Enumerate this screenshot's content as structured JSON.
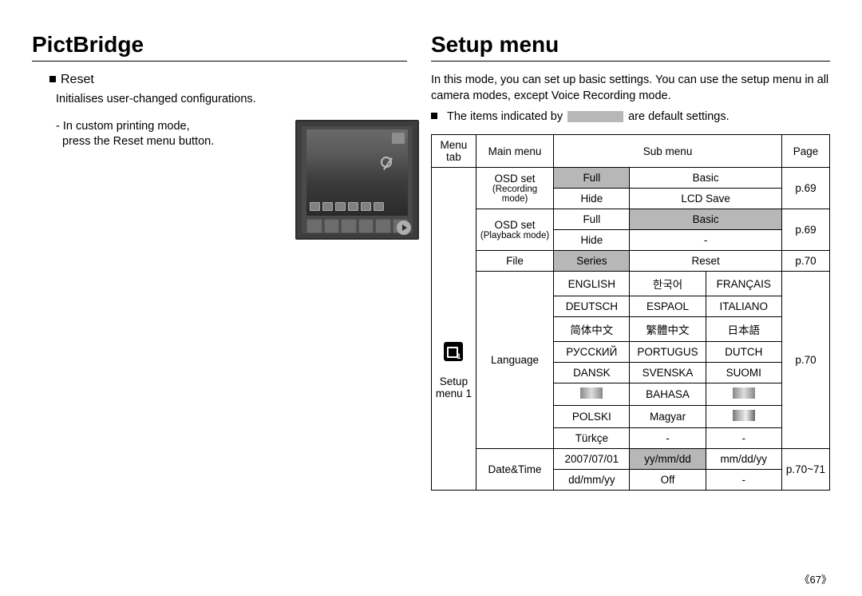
{
  "left": {
    "heading": "PictBridge",
    "section_title": "Reset",
    "desc": "Initialises user-changed configurations.",
    "note1": "- In custom printing mode,",
    "note2": "press the Reset menu button."
  },
  "right": {
    "heading": "Setup menu",
    "intro": "In this mode, you can set up basic settings. You can use the setup menu in all camera modes, except Voice Recording mode.",
    "legend_before": "The items indicated by",
    "legend_after": "are default settings."
  },
  "table": {
    "headers": {
      "tab": "Menu tab",
      "main": "Main menu",
      "sub": "Sub menu",
      "page": "Page"
    },
    "menutab_label": "Setup menu 1",
    "osd_rec": {
      "label": "OSD set",
      "sub": "(Recording mode)",
      "full": "Full",
      "basic": "Basic",
      "hide": "Hide",
      "lcd": "LCD Save",
      "page": "p.69"
    },
    "osd_play": {
      "label": "OSD set",
      "sub": "(Playback mode)",
      "full": "Full",
      "basic": "Basic",
      "hide": "Hide",
      "dash": "-",
      "page": "p.69"
    },
    "file": {
      "label": "File",
      "series": "Series",
      "reset": "Reset",
      "page": "p.70"
    },
    "lang": {
      "label": "Language",
      "rows": [
        [
          "ENGLISH",
          "한국어",
          "FRANÇAIS"
        ],
        [
          "DEUTSCH",
          "ESPAOL",
          "ITALIANO"
        ],
        [
          "简体中文",
          "繁體中文",
          "日本語"
        ],
        [
          "РУССКИЙ",
          "PORTUGUS",
          "DUTCH"
        ],
        [
          "DANSK",
          "SVENSKA",
          "SUOMI"
        ],
        [
          "",
          "BAHASA",
          ""
        ],
        [
          "POLSKI",
          "Magyar",
          ""
        ],
        [
          "Türkçe",
          "-",
          "-"
        ]
      ],
      "page": "p.70"
    },
    "date": {
      "label": "Date&Time",
      "row1": [
        "2007/07/01",
        "yy/mm/dd",
        "mm/dd/yy"
      ],
      "row2": [
        "dd/mm/yy",
        "Off",
        "-"
      ],
      "page": "p.70~71"
    }
  },
  "page_number": "67"
}
